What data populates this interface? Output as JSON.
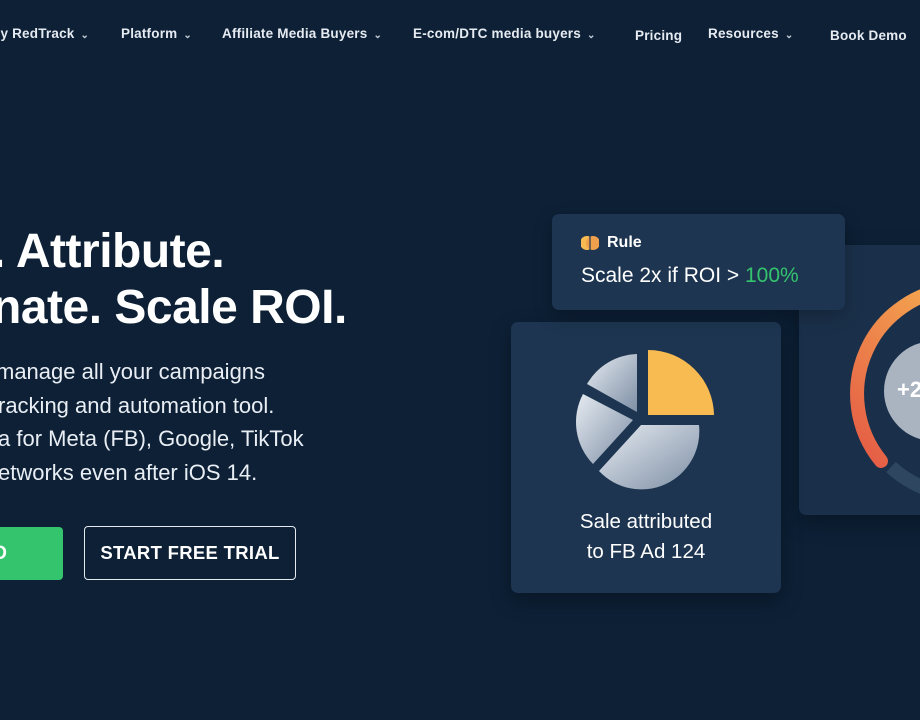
{
  "nav": {
    "items": [
      {
        "label": "hy RedTrack",
        "dropdown": true
      },
      {
        "label": "Platform",
        "dropdown": true
      },
      {
        "label": "Affiliate Media Buyers",
        "dropdown": true
      },
      {
        "label": "E-com/DTC media buyers",
        "dropdown": true
      },
      {
        "label": "Pricing",
        "dropdown": false
      },
      {
        "label": "Resources",
        "dropdown": true
      },
      {
        "label": "Book Demo",
        "dropdown": false
      }
    ]
  },
  "hero": {
    "headline_line1": ". Attribute.",
    "headline_line2": "nate. Scale ROI.",
    "lead_lines": [
      " manage all your campaigns",
      "racking and automation tool.",
      "a for Meta (FB), Google, TikTok",
      "etworks even after iOS 14."
    ],
    "primary_button": "D",
    "secondary_button": "START FREE TRIAL"
  },
  "rule_card": {
    "title": "Rule",
    "text_prefix": "Scale 2x if ROI > ",
    "text_highlight": "100%"
  },
  "sale_card": {
    "line1": "Sale attributed",
    "line2": "to FB Ad 124"
  },
  "gauge_card": {
    "label": "+2"
  },
  "colors": {
    "background": "#0d2036",
    "card": "#1d3550",
    "green": "#35c46e",
    "orange": "#f0a04c",
    "pie_highlight": "#f8bb52"
  }
}
